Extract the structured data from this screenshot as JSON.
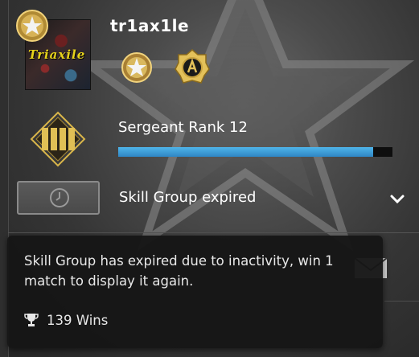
{
  "profile": {
    "username": "tr1ax1le",
    "avatar_text": "Triaxile"
  },
  "rank": {
    "title": "Sergeant Rank 12",
    "xp_progress": 0.93
  },
  "skill_group": {
    "status_text": "Skill Group expired"
  },
  "tooltip": {
    "message": "Skill Group has expired due to inactivity, win 1 match to display it again.",
    "wins_text": "139 Wins"
  },
  "icons": {
    "corner_medal": "service-medal-icon",
    "medal_1": "service-medal-icon",
    "medal_2": "coin-icon",
    "rank": "rank-chevron-icon",
    "clock": "clock-icon",
    "chevron": "chevron-down-icon",
    "trophy": "trophy-icon",
    "mail": "mail-icon"
  },
  "colors": {
    "xp_fill": "#3c9ad8",
    "gold": "#d8b54a"
  }
}
